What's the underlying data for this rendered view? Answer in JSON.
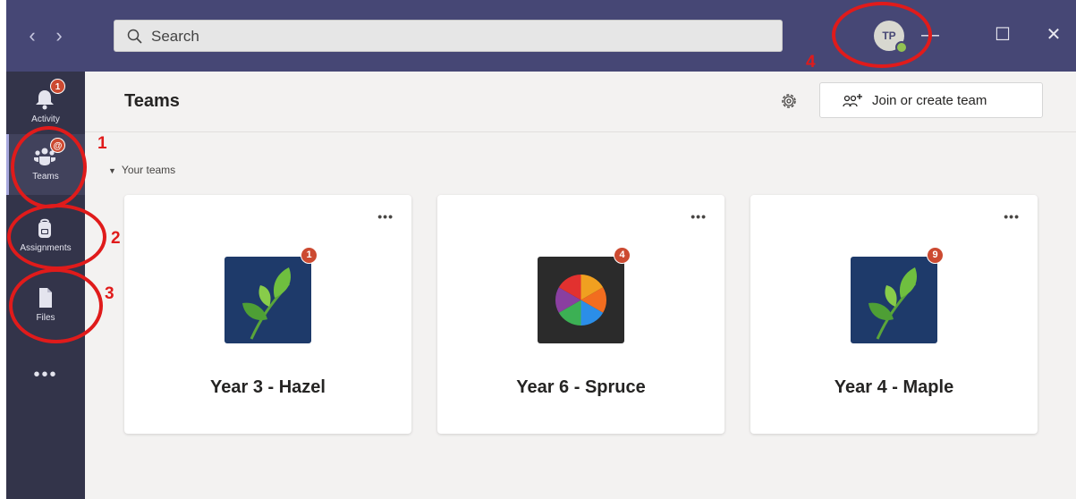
{
  "window": {
    "back_label": "‹",
    "forward_label": "›",
    "search_placeholder": "Search",
    "avatar_initials": "TP",
    "presence_color": "#92c353",
    "minimize_label": "—",
    "maximize_label": "☐",
    "close_label": "✕"
  },
  "appbar": {
    "items": [
      {
        "label": "Activity",
        "icon": "bell-icon",
        "badge": "1"
      },
      {
        "label": "Teams",
        "icon": "teams-icon",
        "badge": "@"
      },
      {
        "label": "Assignments",
        "icon": "backpack-icon"
      },
      {
        "label": "Files",
        "icon": "file-icon"
      }
    ],
    "more_label": "•••"
  },
  "main": {
    "title": "Teams",
    "join_button_label": "Join or create team",
    "section_label": "Your teams",
    "teams": [
      {
        "name": "Year 3 - Hazel",
        "badge": "1",
        "tile": "leaf-icon",
        "tile_color": "#1e3a6a"
      },
      {
        "name": "Year 6 - Spruce",
        "badge": "4",
        "tile": "color-wheel-icon",
        "tile_color": "#2b2b2b"
      },
      {
        "name": "Year 4 - Maple",
        "badge": "9",
        "tile": "leaf-icon",
        "tile_color": "#1e3a6a"
      }
    ],
    "card_more_label": "•••"
  },
  "annotations": [
    "1",
    "2",
    "3",
    "4"
  ],
  "colors": {
    "titlebar": "#464775",
    "appbar": "#33344a",
    "accent": "#a6a7dc",
    "badge": "#cc4a31",
    "annotation": "#e01b1b"
  }
}
